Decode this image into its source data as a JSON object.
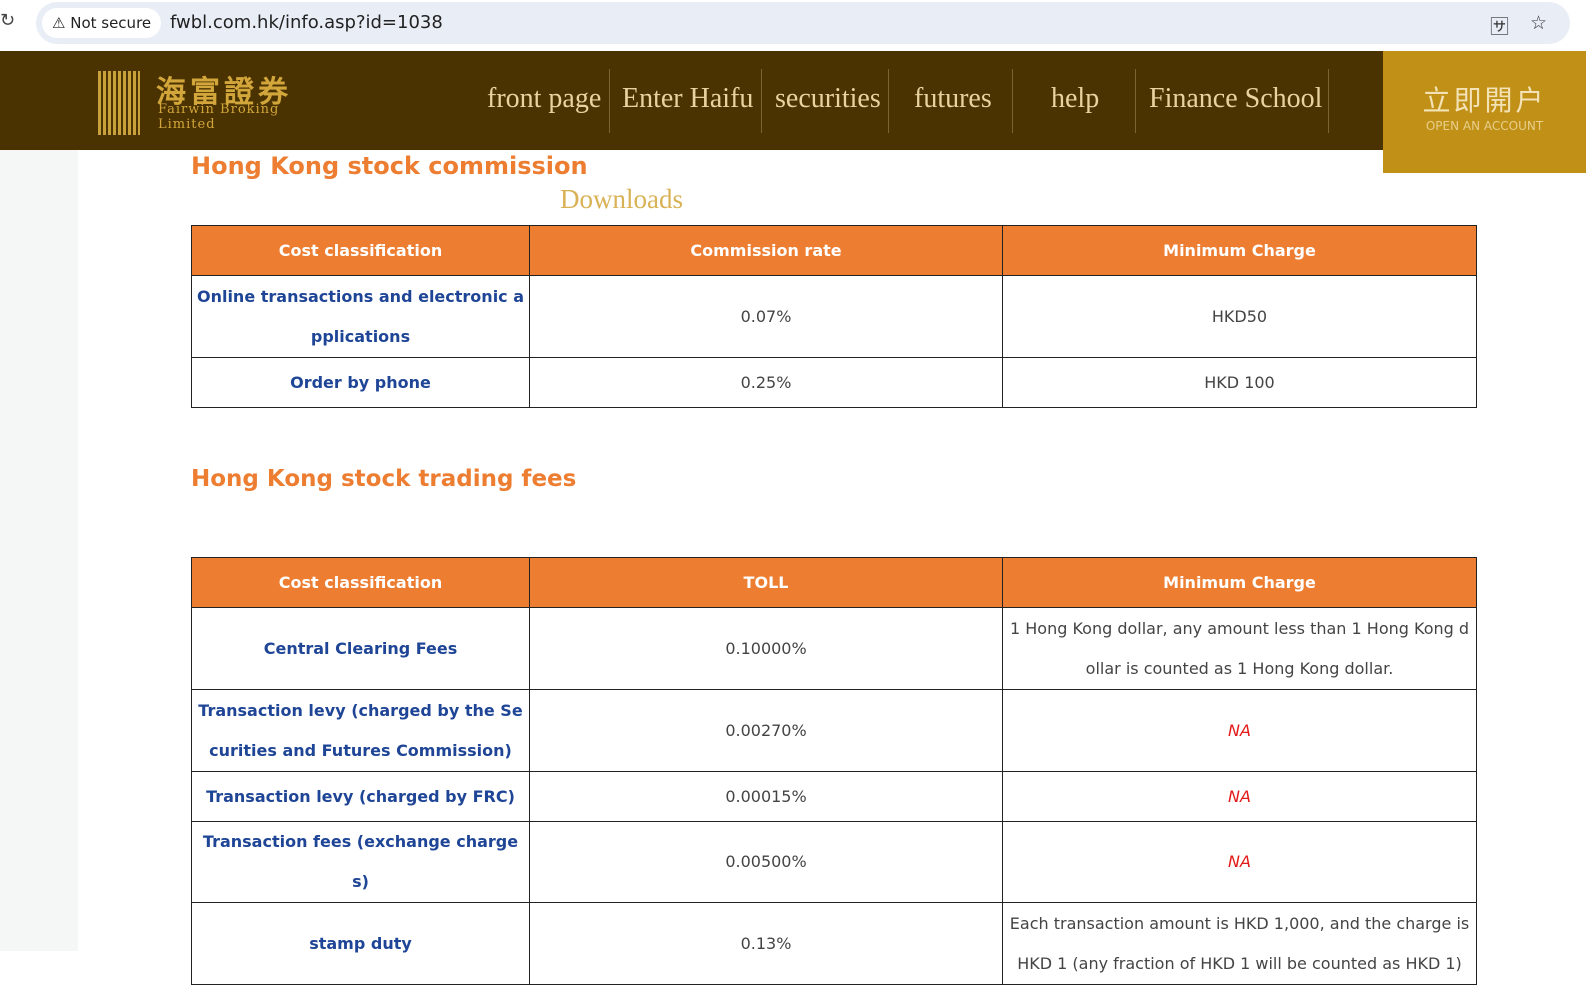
{
  "browser": {
    "security": "Not secure",
    "url": "fwbl.com.hk/info.asp?id=1038"
  },
  "header": {
    "logo_cn": "海富證券",
    "logo_en": "Fairwin Broking Limited",
    "nav": [
      "front page",
      "Enter Haifu",
      "securities",
      "futures",
      "help",
      "Finance School"
    ],
    "open_cn": "立即開户",
    "open_en": "OPEN AN ACCOUNT"
  },
  "section1": {
    "title": "Hong Kong stock commission",
    "downloads": "Downloads",
    "headers": [
      "Cost classification",
      "Commission rate",
      "Minimum Charge"
    ],
    "rows": [
      [
        "Online transactions and electronic applications",
        "0.07%",
        "HKD50"
      ],
      [
        "Order by phone",
        "0.25%",
        "HKD 100"
      ]
    ]
  },
  "section2": {
    "title": "Hong Kong stock trading fees",
    "headers": [
      "Cost classification",
      "TOLL",
      "Minimum Charge"
    ],
    "rows": [
      [
        "Central Clearing Fees",
        "0.10000%",
        "1 Hong Kong dollar, any amount less than 1 Hong Kong dollar is counted as 1 Hong Kong dollar."
      ],
      [
        "Transaction levy (charged by the Securities and Futures Commission)",
        "0.00270%",
        "NA"
      ],
      [
        "Transaction levy (charged by FRC)",
        "0.00015%",
        "NA"
      ],
      [
        "Transaction fees (exchange charges)",
        "0.00500%",
        "NA"
      ],
      [
        "stamp duty",
        "0.13%",
        "Each transaction amount is HKD 1,000, and the charge is HKD 1 (any fraction of HKD 1 will be counted as HKD 1)"
      ]
    ]
  },
  "colors": {
    "header_bg": "#4a3300",
    "accent": "#ed7d31",
    "open_bg": "#c19017",
    "label": "#1f4596",
    "na": "#e21a1a"
  }
}
